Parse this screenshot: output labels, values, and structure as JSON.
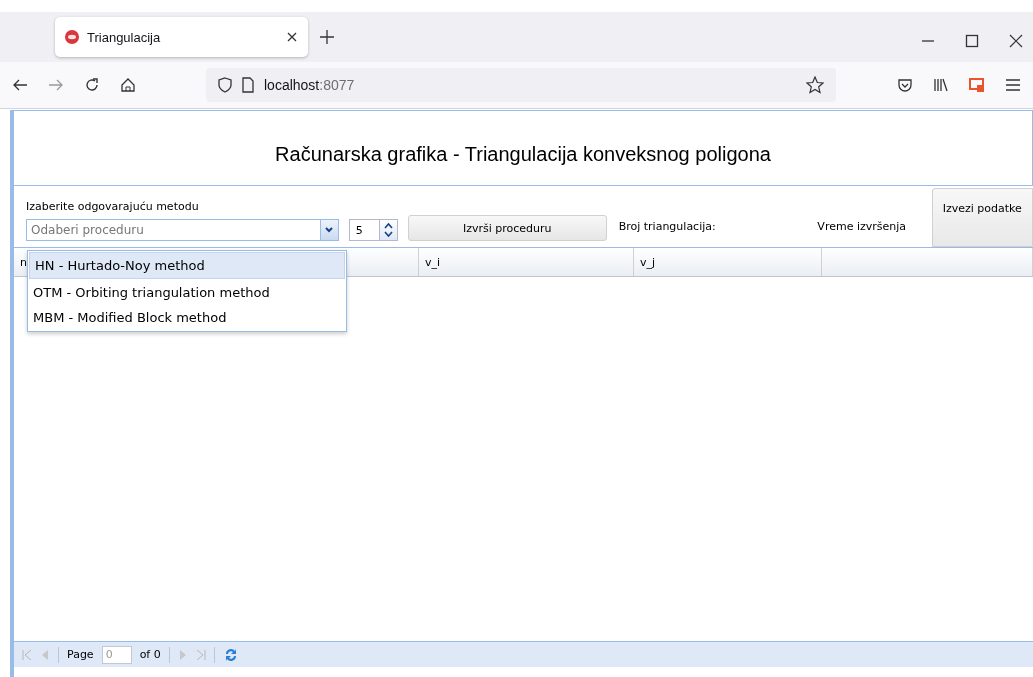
{
  "browser": {
    "tab": {
      "title": "Triangulacija",
      "selected": true
    },
    "address": {
      "host": "localhost",
      "port": ":8077"
    }
  },
  "app": {
    "title": "Računarska grafika - Triangulacija konveksnog poligona",
    "method_label": "Izaberite odgovarajuću metodu",
    "method_combo": {
      "placeholder": "Odaberi proceduru",
      "expanded": true
    },
    "spinner": {
      "value": "5"
    },
    "run_button": "Izvrši proceduru",
    "count_label": "Broj triangulacija:",
    "time_label": "Vreme izvršenja",
    "export_button": "Izvezi podatke",
    "dropdown_options": [
      {
        "label": "HN - Hurtado-Noy method",
        "selected": true
      },
      {
        "label": "OTM - Orbiting triangulation method",
        "selected": false
      },
      {
        "label": "MBM - Modified Block method",
        "selected": false
      }
    ],
    "table": {
      "columns": [
        {
          "label": "n"
        },
        {
          "label": "v_i"
        },
        {
          "label": "v_j"
        }
      ]
    },
    "paging": {
      "page_label": "Page",
      "page_value": "0",
      "of_label": "of 0"
    }
  }
}
